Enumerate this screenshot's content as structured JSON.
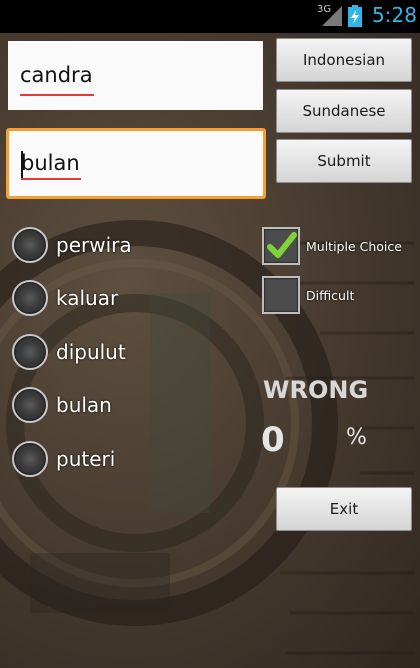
{
  "status_bar": {
    "network": "3G",
    "time": "5:28",
    "accent_color": "#33b5e5"
  },
  "inputs": {
    "word": "candra",
    "answer": "bulan"
  },
  "buttons": {
    "source_lang": "Indonesian",
    "target_lang": "Sundanese",
    "submit": "Submit",
    "exit": "Exit"
  },
  "choices": [
    {
      "label": "perwira"
    },
    {
      "label": "kaluar"
    },
    {
      "label": "dipulut"
    },
    {
      "label": "bulan"
    },
    {
      "label": "puteri"
    }
  ],
  "options": {
    "multiple_choice": {
      "label": "Multiple Choice",
      "checked": true
    },
    "difficult": {
      "label": "Difficult",
      "checked": false
    }
  },
  "result": {
    "status": "WRONG",
    "score": "0",
    "percent_sign": "%"
  },
  "colors": {
    "focus_border": "#f3a030",
    "spellcheck_underline": "#e03a3a",
    "check_green": "#7fd33a"
  }
}
